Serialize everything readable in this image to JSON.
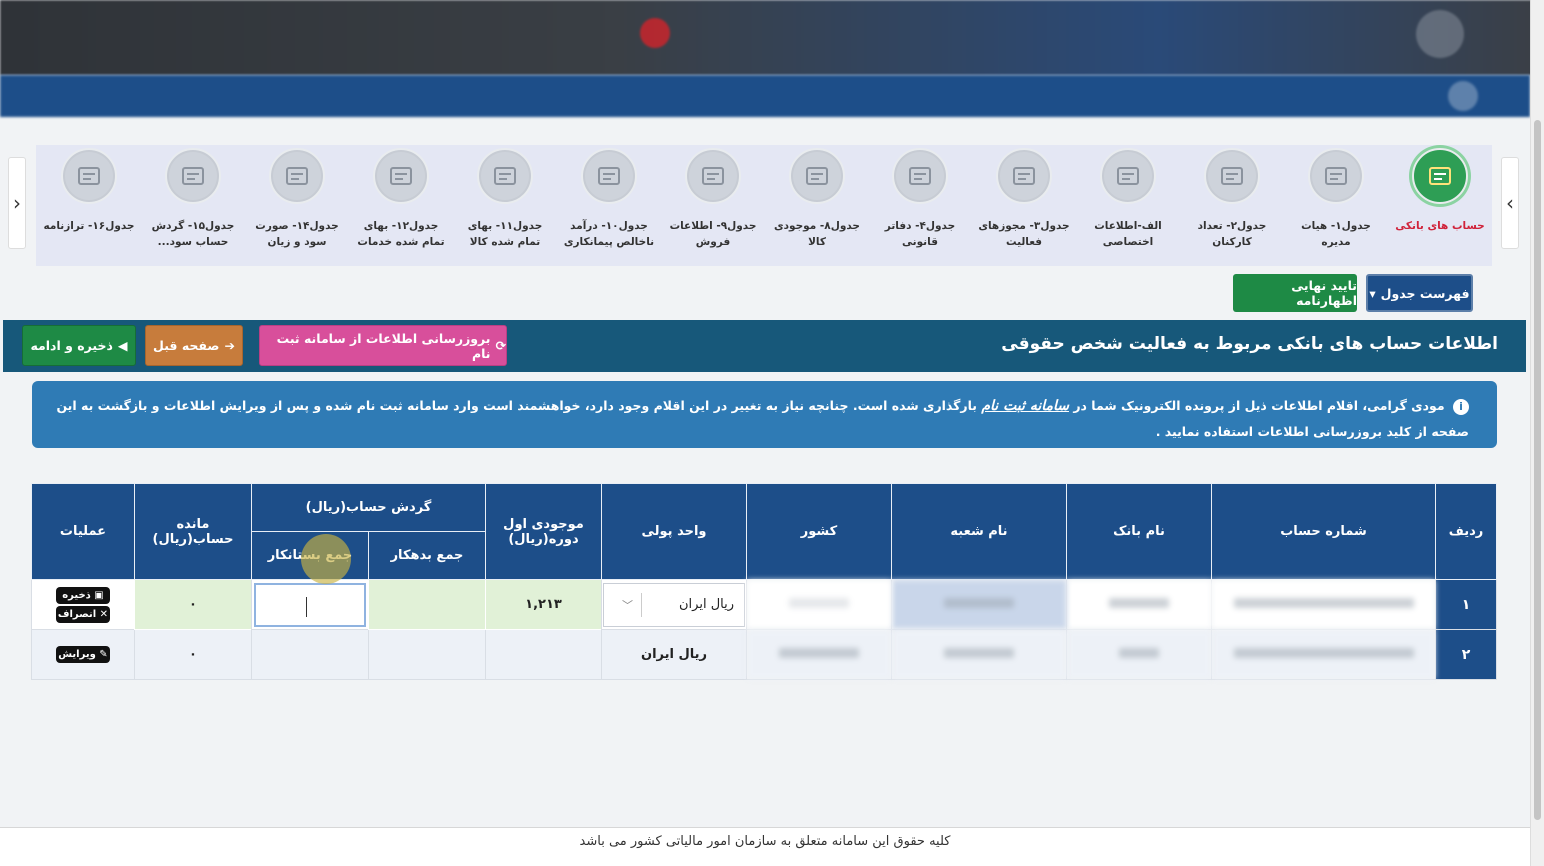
{
  "carousel": {
    "items": [
      {
        "label": "حساب های بانکی",
        "icon": "bank-icon",
        "active": true
      },
      {
        "label": "جدول۱- هیات مدیره",
        "icon": "board-icon"
      },
      {
        "label": "جدول۲- تعداد کارکنان",
        "icon": "staff-icon"
      },
      {
        "label": "الف-اطلاعات اختصاصی",
        "icon": "id-card-icon"
      },
      {
        "label": "جدول۳- مجوزهای فعالیت",
        "icon": "license-icon"
      },
      {
        "label": "جدول۴- دفاتر قانونی",
        "icon": "books-icon"
      },
      {
        "label": "جدول۸- موجودی کالا",
        "icon": "inventory-icon"
      },
      {
        "label": "جدول۹- اطلاعات فروش",
        "icon": "sales-icon"
      },
      {
        "label": "جدول۱۰- درآمد ناخالص پیمانکاری",
        "icon": "contract-icon"
      },
      {
        "label": "جدول۱۱- بهای تمام شده کالا",
        "icon": "calculator-icon"
      },
      {
        "label": "جدول۱۲- بهای تمام شده خدمات",
        "icon": "services-icon"
      },
      {
        "label": "جدول۱۴- صورت سود و زیان",
        "icon": "balance-scale-icon"
      },
      {
        "label": "جدول۱۵- گردش حساب سود...",
        "icon": "profit-icon"
      },
      {
        "label": "جدول۱۶- ترازنامه",
        "icon": "ledger-icon"
      }
    ]
  },
  "buttons": {
    "table_list": "فهرست جدول",
    "final_confirm": "تایید نهایی اظهارنامه",
    "update": "بروزرسانی اطلاعات از سامانه ثبت نام",
    "prev": "صفحه قبل",
    "save": "ذخیره و ادامه"
  },
  "page": {
    "title": "اطلاعات حساب های بانکی مربوط به فعالیت شخص حقوقی"
  },
  "alert": {
    "part1": "مودی گرامی، اقلام اطلاعات ذیل از پرونده الکترونیک شما در",
    "link": "سامانه ثبت نام",
    "part2": "بارگذاری شده است. چنانچه نیاز به تغییر در این اقلام وجود دارد، خواهشمند است وارد سامانه ثبت نام شده و پس از ویرایش اطلاعات و بازگشت به این صفحه از کلید بروزرسانی اطلاعات استفاده نمایید ."
  },
  "table": {
    "headers": {
      "row": "ردیف",
      "account": "شماره حساب",
      "bank": "نام بانک",
      "branch": "نام شعبه",
      "country": "کشور",
      "currency": "واحد پولی",
      "opening": "موجودی اول دوره(ریال)",
      "turnover": "گردش حساب(ریال)",
      "debit": "جمع بدهکار",
      "credit": "جمع بستانکار",
      "balance": "مانده حساب(ریال)",
      "ops": "عملیات"
    },
    "rows": [
      {
        "num": "۱",
        "currency": "ریال ایران",
        "opening": "۱,۲۱۳",
        "debit": "",
        "credit": "",
        "balance": "۰",
        "save": "ذخیره",
        "cancel": "انصراف"
      },
      {
        "num": "۲",
        "currency": "ریال ایران",
        "opening": "",
        "debit": "",
        "credit": "",
        "balance": "۰",
        "edit": "ویرایش"
      }
    ]
  },
  "footer": {
    "text": "کلیه حقوق این سامانه متعلق به سازمان امور مالیاتی کشور می باشد"
  }
}
